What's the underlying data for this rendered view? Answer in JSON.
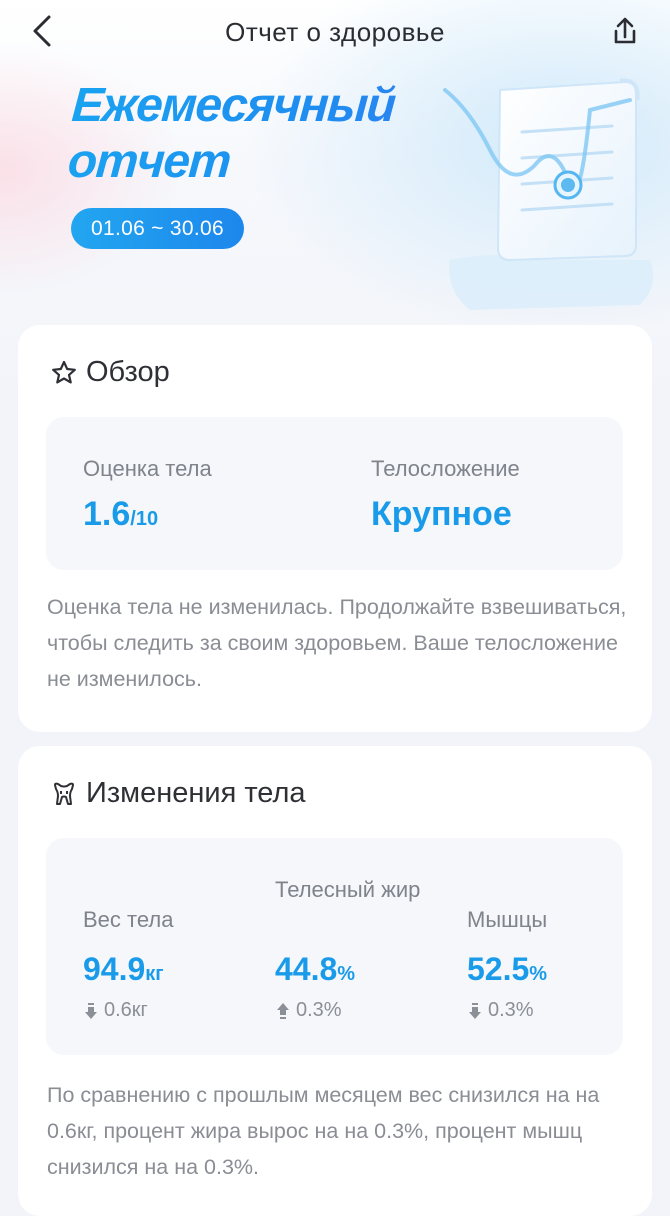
{
  "navbar": {
    "title": "Отчет о здоровье",
    "back_icon": "chevron-left-icon",
    "share_icon": "share-icon"
  },
  "hero": {
    "title_line1": "Ежемесячный",
    "title_line2": "отчет",
    "date_range": "01.06 ~ 30.06"
  },
  "overview": {
    "title": "Обзор",
    "icon": "star-outline-icon",
    "body_score_label": "Оценка тела",
    "body_score_value": "1.6",
    "body_score_max": "/10",
    "body_type_label": "Телосложение",
    "body_type_value": "Крупное",
    "summary": "Оценка тела не изменилась. Продолжайте взвешиваться, чтобы следить за своим здоровьем. Ваше телосложение не изменилось."
  },
  "body_changes": {
    "title": "Изменения тела",
    "icon": "body-icon",
    "metrics": [
      {
        "label": "Вес тела",
        "value": "94.9",
        "unit": "кг",
        "direction": "down",
        "delta": "0.6кг"
      },
      {
        "label": "Телесный жир",
        "value": "44.8",
        "unit": "%",
        "direction": "up",
        "delta": "0.3%"
      },
      {
        "label": "Мышцы",
        "value": "52.5",
        "unit": "%",
        "direction": "down",
        "delta": "0.3%"
      }
    ],
    "summary": "По сравнению с прошлым месяцем вес снизился на на 0.6кг, процент жира вырос на на 0.3%, процент мышц снизился на на 0.3%."
  },
  "colors": {
    "accent": "#1a9be9",
    "muted_text": "#8a8d94",
    "card_bg": "#ffffff",
    "inner_bg": "#f5f7fa"
  }
}
